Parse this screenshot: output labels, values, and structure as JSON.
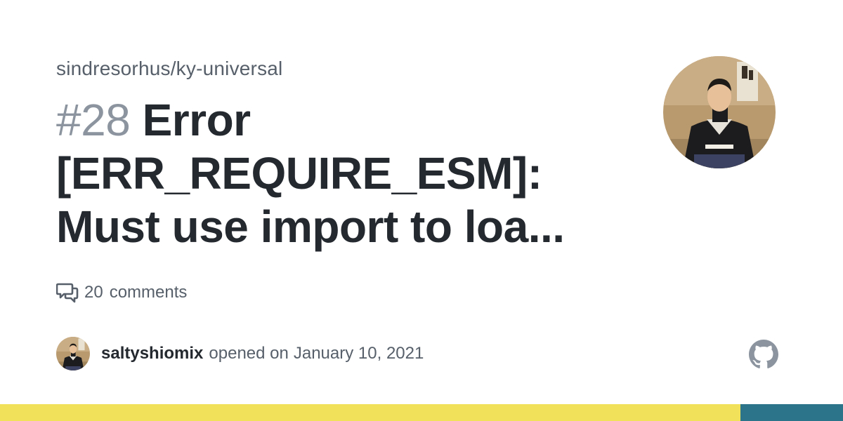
{
  "repo": "sindresorhus/ky-universal",
  "issue": {
    "number": "#28",
    "title_line1": "Error",
    "title_line2": "[ERR_REQUIRE_ESM]:",
    "title_line3": "Must use import to loa..."
  },
  "comments": {
    "count": "20",
    "label": "comments",
    "icon": "comment-discussion-icon"
  },
  "author": {
    "username": "saltyshiomix",
    "opened_label": "opened on",
    "date": "January 10, 2021"
  },
  "icons": {
    "brand": "github-logo-icon"
  },
  "colors": {
    "language_primary": "#f1e05a",
    "language_secondary": "#2b7489",
    "text_primary": "#24292f",
    "text_muted": "#57606a",
    "issue_number": "#8c959f"
  }
}
